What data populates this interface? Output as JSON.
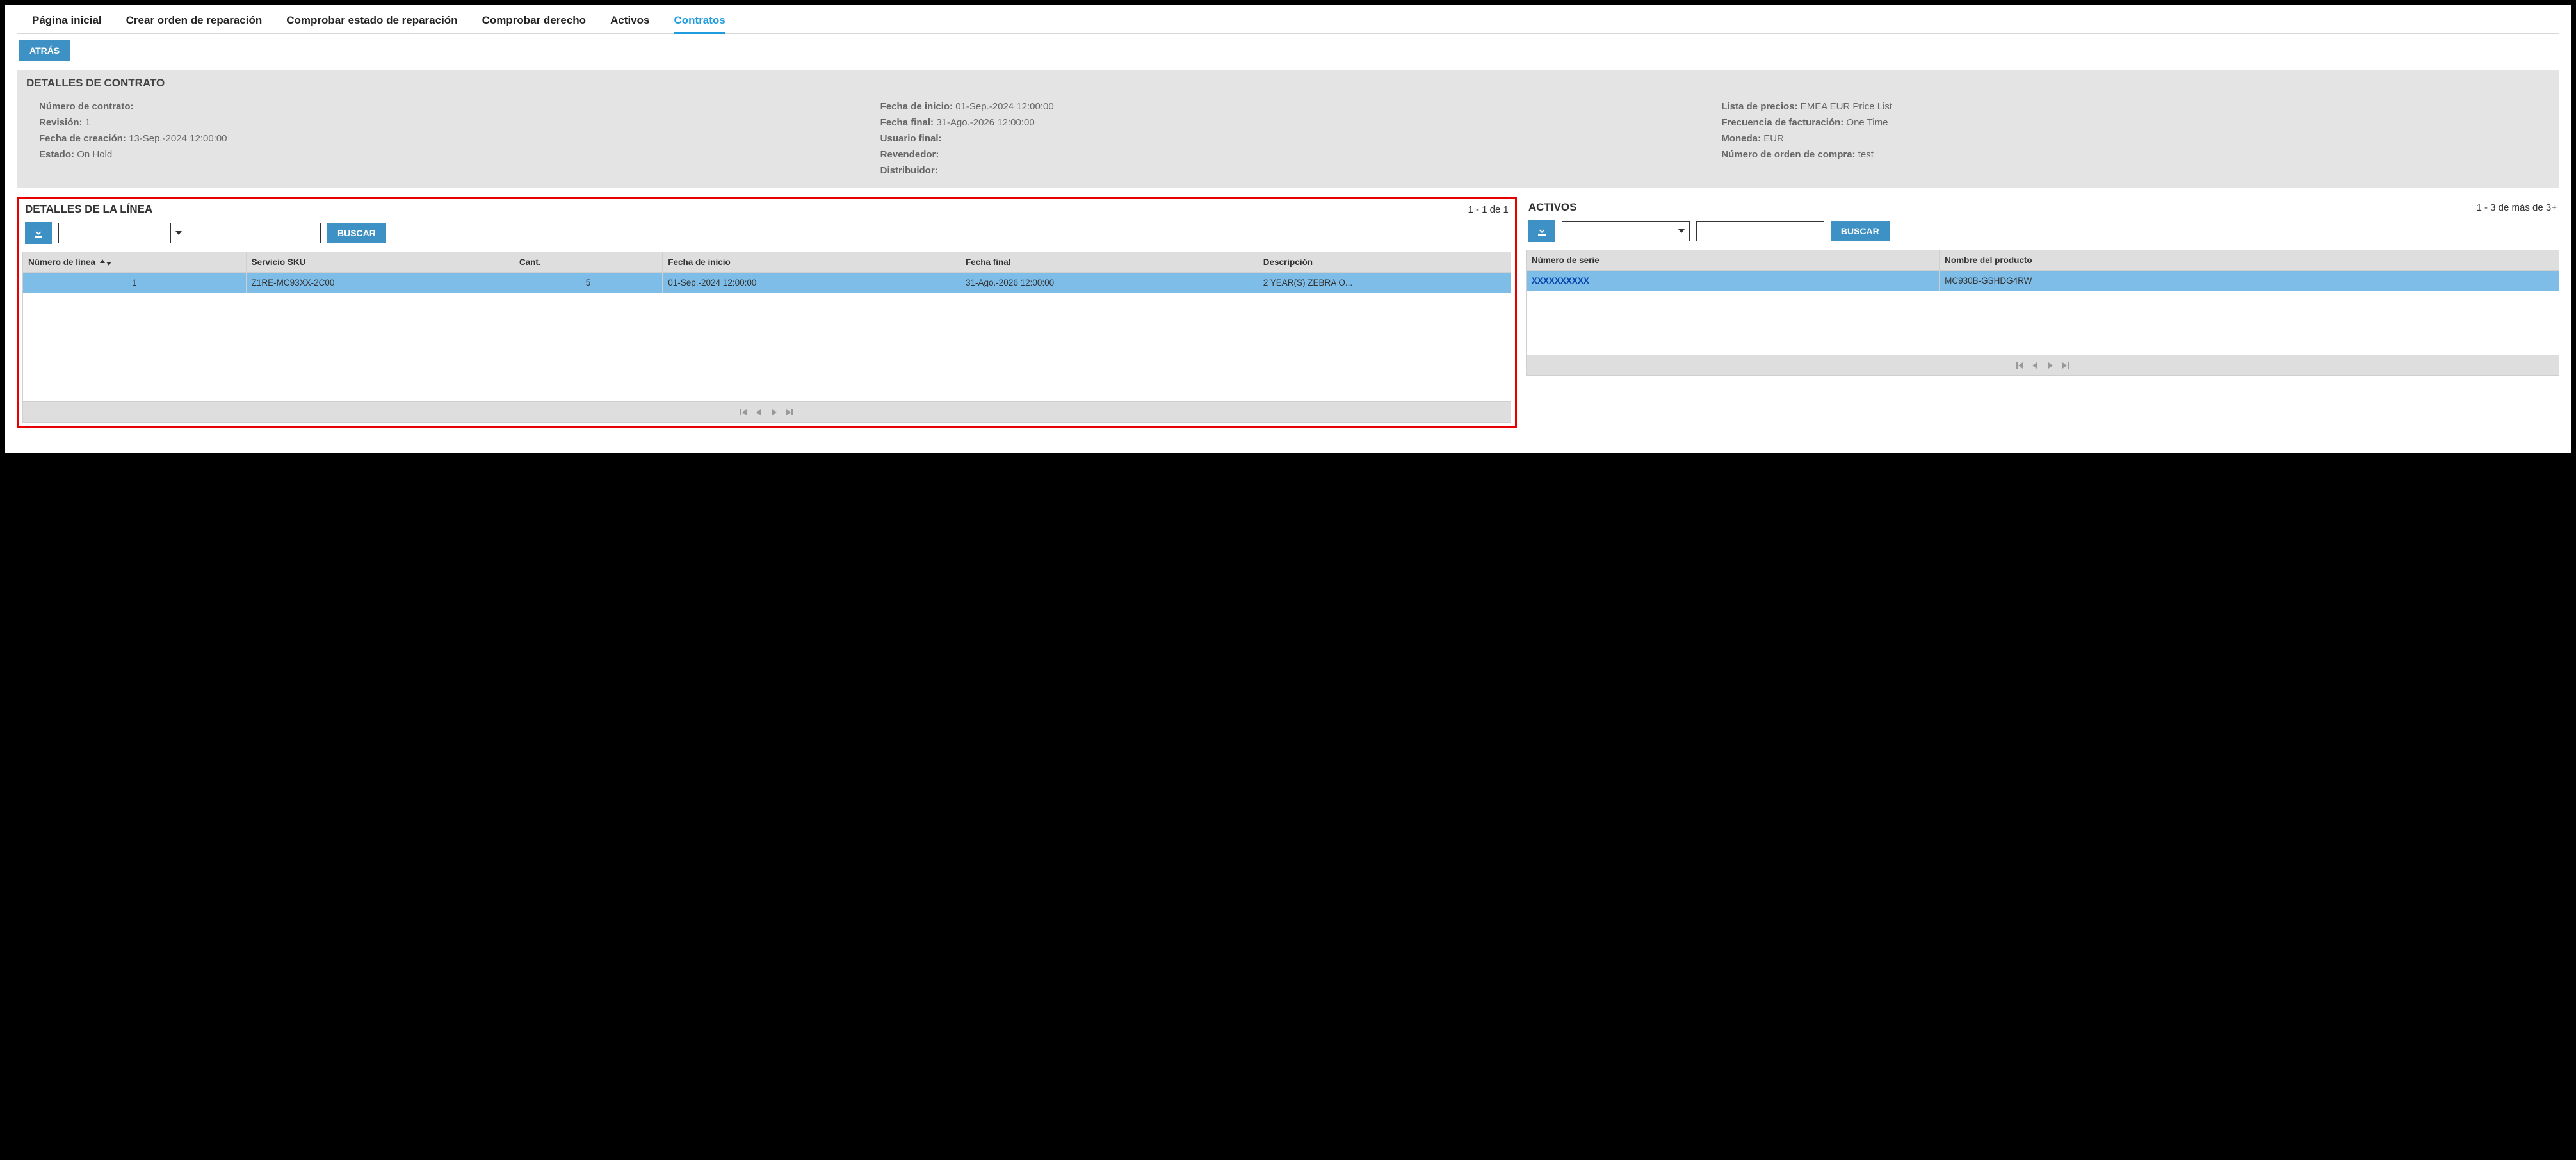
{
  "tabs": {
    "items": [
      {
        "label": "Página inicial",
        "active": false
      },
      {
        "label": "Crear orden de reparación",
        "active": false
      },
      {
        "label": "Comprobar estado de reparación",
        "active": false
      },
      {
        "label": "Comprobar derecho",
        "active": false
      },
      {
        "label": "Activos",
        "active": false
      },
      {
        "label": "Contratos",
        "active": true
      }
    ]
  },
  "back_button": "ATRÁS",
  "contract_panel": {
    "title": "DETALLES DE CONTRATO",
    "col1": {
      "contract_number_lbl": "Número de contrato:",
      "contract_number_val": "",
      "revision_lbl": "Revisión:",
      "revision_val": "1",
      "creation_date_lbl": "Fecha de creación:",
      "creation_date_val": "13-Sep.-2024 12:00:00",
      "status_lbl": "Estado:",
      "status_val": "On Hold"
    },
    "col2": {
      "start_date_lbl": "Fecha de inicio:",
      "start_date_val": "01-Sep.-2024 12:00:00",
      "end_date_lbl": "Fecha final:",
      "end_date_val": "31-Ago.-2026 12:00:00",
      "end_user_lbl": "Usuario final:",
      "end_user_val": "",
      "reseller_lbl": "Revendedor:",
      "reseller_val": "",
      "distributor_lbl": "Distribuidor:",
      "distributor_val": ""
    },
    "col3": {
      "price_list_lbl": "Lista de precios:",
      "price_list_val": "EMEA EUR Price List",
      "billing_freq_lbl": "Frecuencia de facturación:",
      "billing_freq_val": "One Time",
      "currency_lbl": "Moneda:",
      "currency_val": "EUR",
      "po_number_lbl": "Número de orden de compra:",
      "po_number_val": "test"
    }
  },
  "line_section": {
    "title": "DETALLES DE LA LÍNEA",
    "range": "1 - 1 de 1",
    "search_btn": "BUSCAR",
    "columns": {
      "line_no": "Número de línea",
      "sku": "Servicio SKU",
      "qty": "Cant.",
      "start": "Fecha de inicio",
      "end": "Fecha final",
      "desc": "Descripción"
    },
    "rows": [
      {
        "line_no": "1",
        "sku": "Z1RE-MC93XX-2C00",
        "qty": "5",
        "start": "01-Sep.-2024 12:00:00",
        "end": "31-Ago.-2026 12:00:00",
        "desc": "2 YEAR(S) ZEBRA O..."
      }
    ]
  },
  "assets_section": {
    "title": "ACTIVOS",
    "range": "1 - 3 de más de 3+",
    "search_btn": "BUSCAR",
    "columns": {
      "serial": "Número de serie",
      "product": "Nombre del producto"
    },
    "rows": [
      {
        "serial": "XXXXXXXXXX",
        "product": "MC930B-GSHDG4RW"
      }
    ]
  }
}
